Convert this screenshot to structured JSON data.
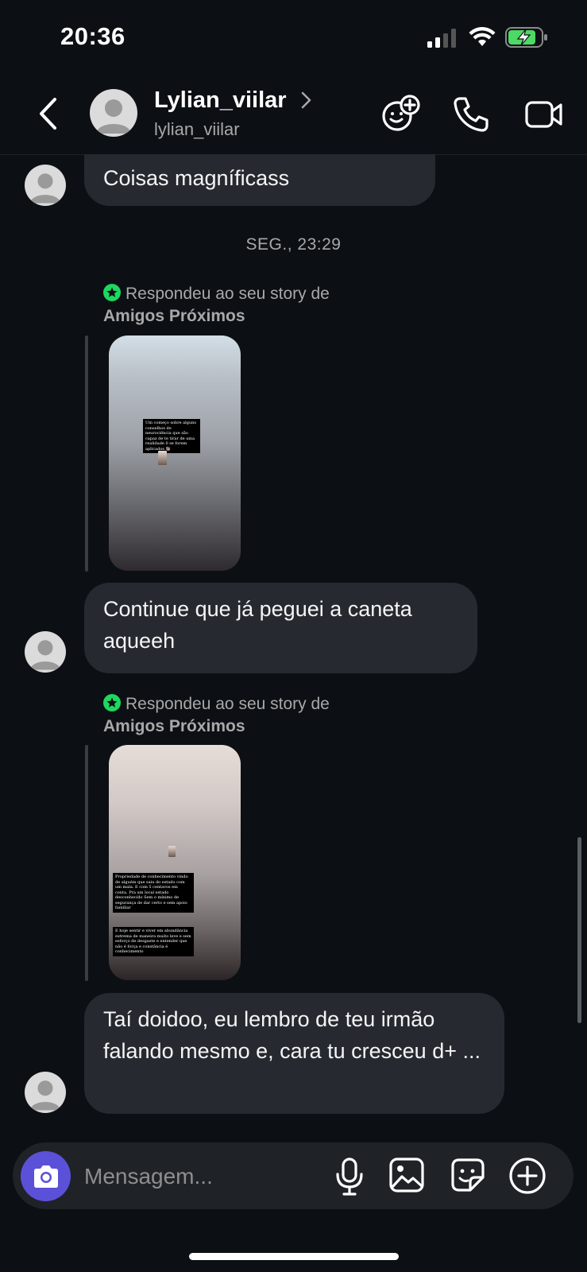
{
  "status_bar": {
    "time": "20:36"
  },
  "header": {
    "display_name": "Lylian_viilar",
    "username": "lylian_viilar"
  },
  "messages": [
    {
      "type": "text",
      "text": "Coisas magníficass"
    },
    {
      "type": "date",
      "text": "SEG., 23:29"
    },
    {
      "type": "story_reply",
      "label": "Respondeu ao seu story de",
      "audience": "Amigos Próximos"
    },
    {
      "type": "text",
      "text": "Continue que já peguei a caneta aqueeh"
    },
    {
      "type": "story_reply",
      "label": "Respondeu ao seu story de",
      "audience": "Amigos Próximos"
    },
    {
      "type": "text",
      "text": "Taí doidoo, eu lembro de teu irmão falando mesmo e, cara tu cresceu d+ ..."
    }
  ],
  "stories": [
    {
      "text": "Um começo sobre alguns conselhos de neurociência que são capaz de te tirar de uma realidade 0 se forem aplicados 📚"
    },
    {
      "text_1": "Propriedade de conhecimento vindo de alguém que saiu do estado com um mala. E com 5 centavos em conta. Pra um local estado desconhecido Sem o mínimo de segurança de dar certo e sem apoio familiar",
      "text_2": "E hoje sentir e viver em abundância extrema de maneira muito leve e sem esforço de desgaste e entender que não é força e constância é conhecimento"
    }
  ],
  "composer": {
    "placeholder": "Mensagem..."
  },
  "icons": {
    "back": "chevron-left-icon",
    "game": "game-controller-icon",
    "call": "phone-icon",
    "video": "video-camera-icon",
    "camera": "camera-icon",
    "mic": "microphone-icon",
    "gallery": "image-icon",
    "sticker": "sticker-icon",
    "plus": "plus-circle-icon"
  },
  "colors": {
    "background": "#0c1014",
    "bubble": "#262a30",
    "camera_button": "#5b51d8",
    "close_friends_green": "#1ed760",
    "battery_green": "#4cd964"
  }
}
